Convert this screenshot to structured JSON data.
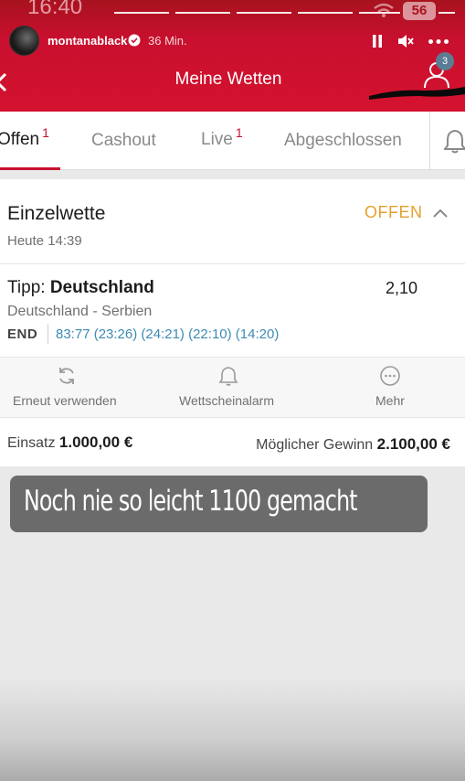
{
  "status_bar": {
    "time": "16:40",
    "battery": "56"
  },
  "story": {
    "username": "montanablack",
    "post_age": "36 Min."
  },
  "header": {
    "title": "Meine Wetten",
    "user_badge_count": "3"
  },
  "tabs": [
    {
      "label": "Offen",
      "count": "1"
    },
    {
      "label": "Cashout",
      "count": ""
    },
    {
      "label": "Live",
      "count": "1"
    },
    {
      "label": "Abgeschlossen",
      "count": ""
    }
  ],
  "bet": {
    "type": "Einzelwette",
    "date": "Heute 14:39",
    "status": "OFFEN",
    "tipp_prefix": "Tipp:",
    "tipp_team": "Deutschland",
    "odds": "2,10",
    "match": "Deutschland - Serbien",
    "end_label": "END",
    "score": "83:77 (23:26) (24:21) (22:10) (14:20)",
    "actions": [
      {
        "label": "Erneut verwenden",
        "icon": "refresh-icon"
      },
      {
        "label": "Wettscheinalarm",
        "icon": "bell-icon"
      },
      {
        "label": "Mehr",
        "icon": "more-icon"
      }
    ],
    "stake_label": "Einsatz",
    "stake_value": "1.000,00 €",
    "win_label": "Möglicher Gewinn",
    "win_value": "2.100,00 €"
  },
  "caption": "Noch nie so leicht 1100 gemacht",
  "colors": {
    "brand_red": "#c8102e",
    "status_orange": "#e3a12a",
    "score_blue": "#3d8bb5"
  }
}
